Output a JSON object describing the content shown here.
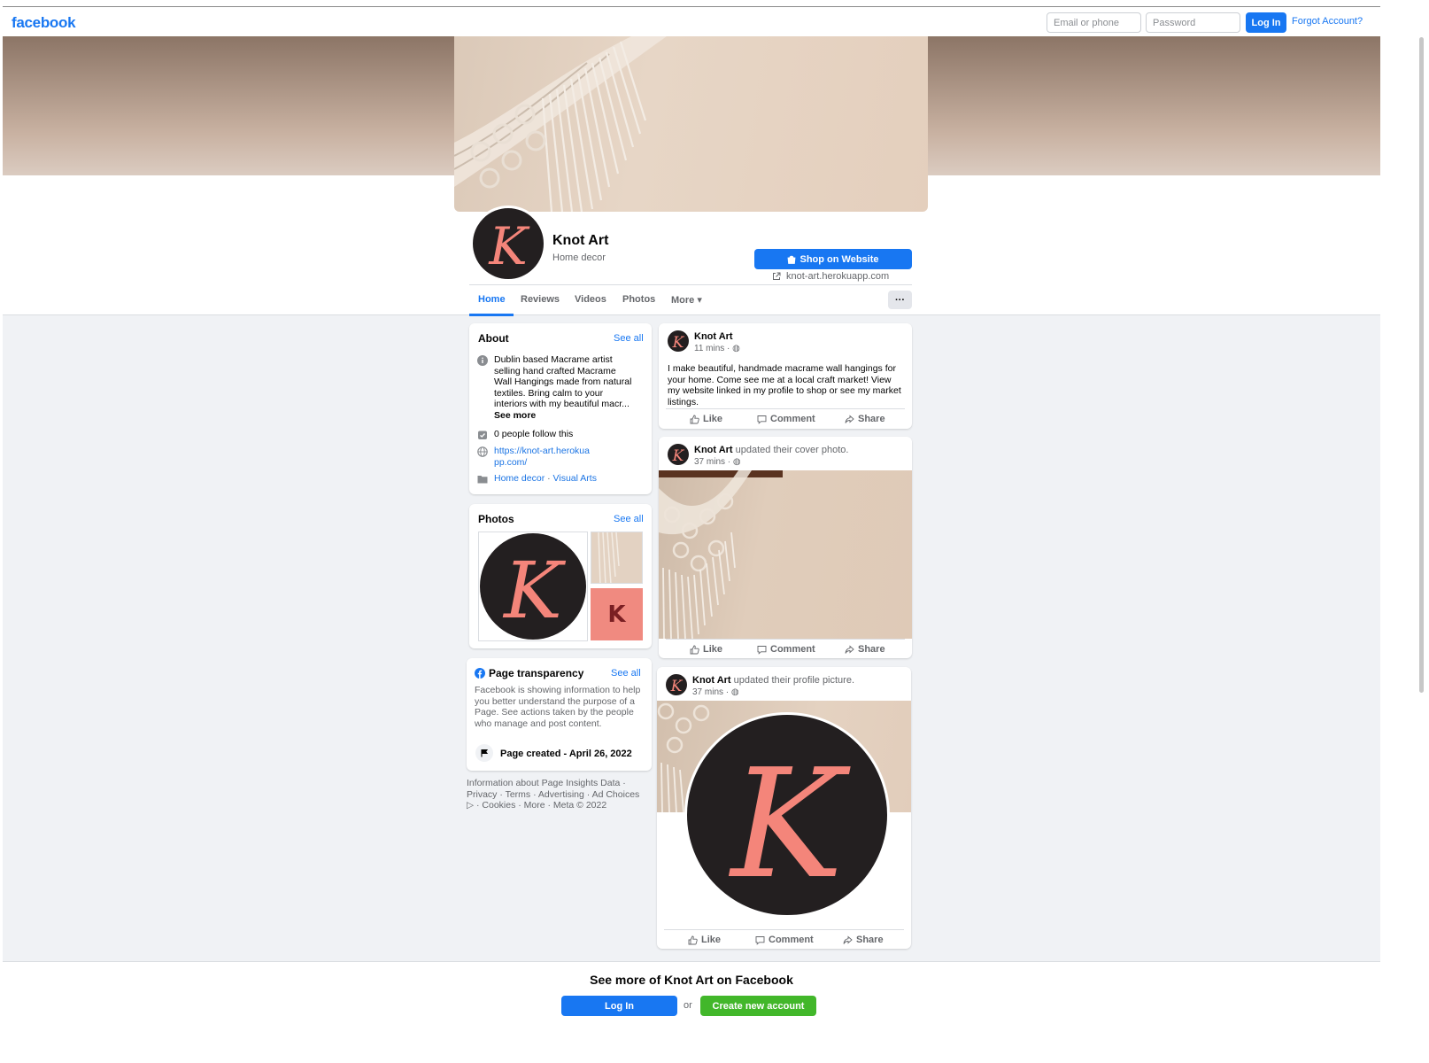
{
  "topnav": {
    "logo": "facebook",
    "email_placeholder": "Email or phone",
    "password_placeholder": "Password",
    "login_label": "Log In",
    "forgot_label": "Forgot Account?"
  },
  "profile": {
    "name": "Knot Art",
    "category": "Home decor",
    "shop_label": "Shop on Website",
    "website": "knot-art.herokuapp.com"
  },
  "tabs": {
    "items": [
      "Home",
      "Reviews",
      "Videos",
      "Photos",
      "More ▾"
    ],
    "more_button": "···"
  },
  "about": {
    "title": "About",
    "see_all": "See all",
    "description": "Dublin based Macrame artist selling hand crafted Macrame Wall Hangings made from natural textiles. Bring calm to your interiors with my beautiful macr...",
    "see_more": "See more",
    "followers": "0 people follow this",
    "url": "https://knot-art.herokuapp.com/",
    "category1": "Home decor",
    "separator": " · ",
    "category2": "Visual Arts"
  },
  "photos": {
    "title": "Photos",
    "see_all": "See all"
  },
  "transparency": {
    "title": "Page transparency",
    "see_all": "See all",
    "text": "Facebook is showing information to help you better understand the purpose of a Page. See actions taken by the people who manage and post content.",
    "page_created": "Page created - April 26, 2022"
  },
  "footer": {
    "text": "Information about Page Insights Data · Privacy · Terms · Advertising · Ad Choices ▷ · Cookies · More · Meta © 2022"
  },
  "posts": [
    {
      "author": "Knot Art",
      "action": "",
      "time": "11 mins · ◍",
      "text": "I make beautiful, handmade macrame wall hangings for your home. Come see me at a local craft market! View my website linked in my profile to shop or see my market listings."
    },
    {
      "author": "Knot Art",
      "action": " updated their cover photo.",
      "time": "37 mins · ◍",
      "text": ""
    },
    {
      "author": "Knot Art",
      "action": " updated their profile picture.",
      "time": "37 mins · ◍",
      "text": ""
    }
  ],
  "post_actions": {
    "like": "Like",
    "comment": "Comment",
    "share": "Share"
  },
  "bottom": {
    "title": "See more of Knot Art on Facebook",
    "login": "Log In",
    "or": "or",
    "create": "Create new account"
  },
  "logo_letter": "K",
  "colors": {
    "brand_blue": "#1877f2",
    "create_green": "#42b72a",
    "logo_dark": "#231f20",
    "logo_salmon": "#f4857a"
  }
}
